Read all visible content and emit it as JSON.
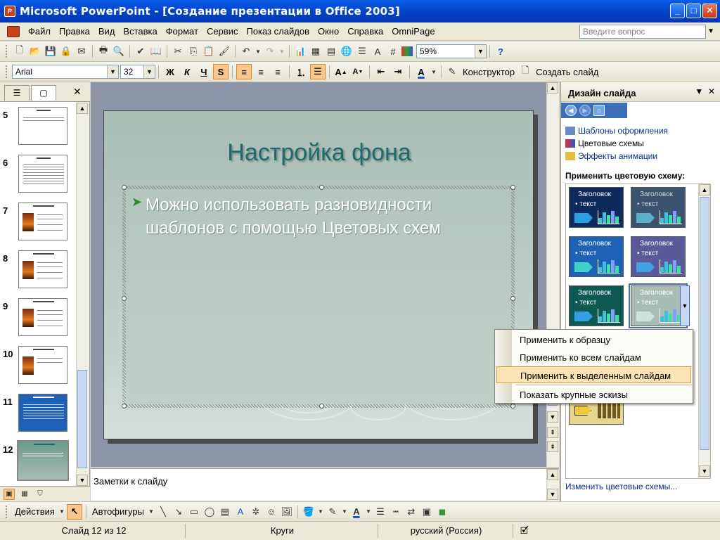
{
  "window": {
    "title": "Microsoft PowerPoint - [Создание презентации в Office 2003]",
    "minimize": "_",
    "maximize": "□",
    "close": "✕"
  },
  "menu": {
    "items": [
      "Файл",
      "Правка",
      "Вид",
      "Вставка",
      "Формат",
      "Сервис",
      "Показ слайдов",
      "Окно",
      "Справка",
      "OmniPage"
    ],
    "help_placeholder": "Введите вопрос"
  },
  "standard_toolbar": {
    "zoom": "59%"
  },
  "format_toolbar": {
    "font": "Arial",
    "size": "32",
    "bold": "Ж",
    "italic": "К",
    "underline": "Ч",
    "shadow": "S",
    "designer": "Конструктор",
    "new_slide": "Создать слайд"
  },
  "left_pane": {
    "slides": [
      {
        "num": "5"
      },
      {
        "num": "6"
      },
      {
        "num": "7"
      },
      {
        "num": "8"
      },
      {
        "num": "9"
      },
      {
        "num": "10"
      },
      {
        "num": "11"
      },
      {
        "num": "12"
      }
    ]
  },
  "slide": {
    "title": "Настройка фона",
    "bullet": "Можно использовать разновидности шаблонов с помощью Цветовых схем"
  },
  "notes": {
    "label": "Заметки к слайду"
  },
  "task_pane": {
    "title": "Дизайн слайда",
    "links": [
      "Шаблоны оформления",
      "Цветовые схемы",
      "Эффекты анимации"
    ],
    "apply_label": "Применить цветовую схему:",
    "schemes": [
      {
        "header": "Заголовок",
        "text": "• текст",
        "bg": "#0e2a5a",
        "header_color": "#ffffff",
        "shape": "#2aa0e0"
      },
      {
        "header": "Заголовок",
        "text": "• текст",
        "bg": "#3a5470",
        "header_color": "#d0d8e0",
        "shape": "#5ab0c8"
      },
      {
        "header": "Заголовок",
        "text": "• текст",
        "bg": "#1e62b8",
        "header_color": "#ffffff",
        "shape": "#40d0c8"
      },
      {
        "header": "Заголовок",
        "text": "• текст",
        "bg": "#5a5a9a",
        "header_color": "#ffffff",
        "shape": "#40a0e0"
      },
      {
        "header": "Заголовок",
        "text": "• текст",
        "bg": "#0e5a52",
        "header_color": "#ffffff",
        "shape": "#30a0e0"
      },
      {
        "header": "Заголовок",
        "text": "• текст",
        "bg": "#a9bdb4",
        "header_color": "#ffffff",
        "shape": "#d0e0da"
      }
    ],
    "more": "Изменить цветовые схемы..."
  },
  "context_menu": {
    "items": [
      "Применить к образцу",
      "Применить ко всем слайдам",
      "Применить к выделенным слайдам",
      "Показать крупные эскизы"
    ]
  },
  "draw_toolbar": {
    "actions": "Действия",
    "autoshapes": "Автофигуры"
  },
  "status_bar": {
    "slide": "Слайд 12 из 12",
    "design": "Круги",
    "language": "русский (Россия)"
  }
}
